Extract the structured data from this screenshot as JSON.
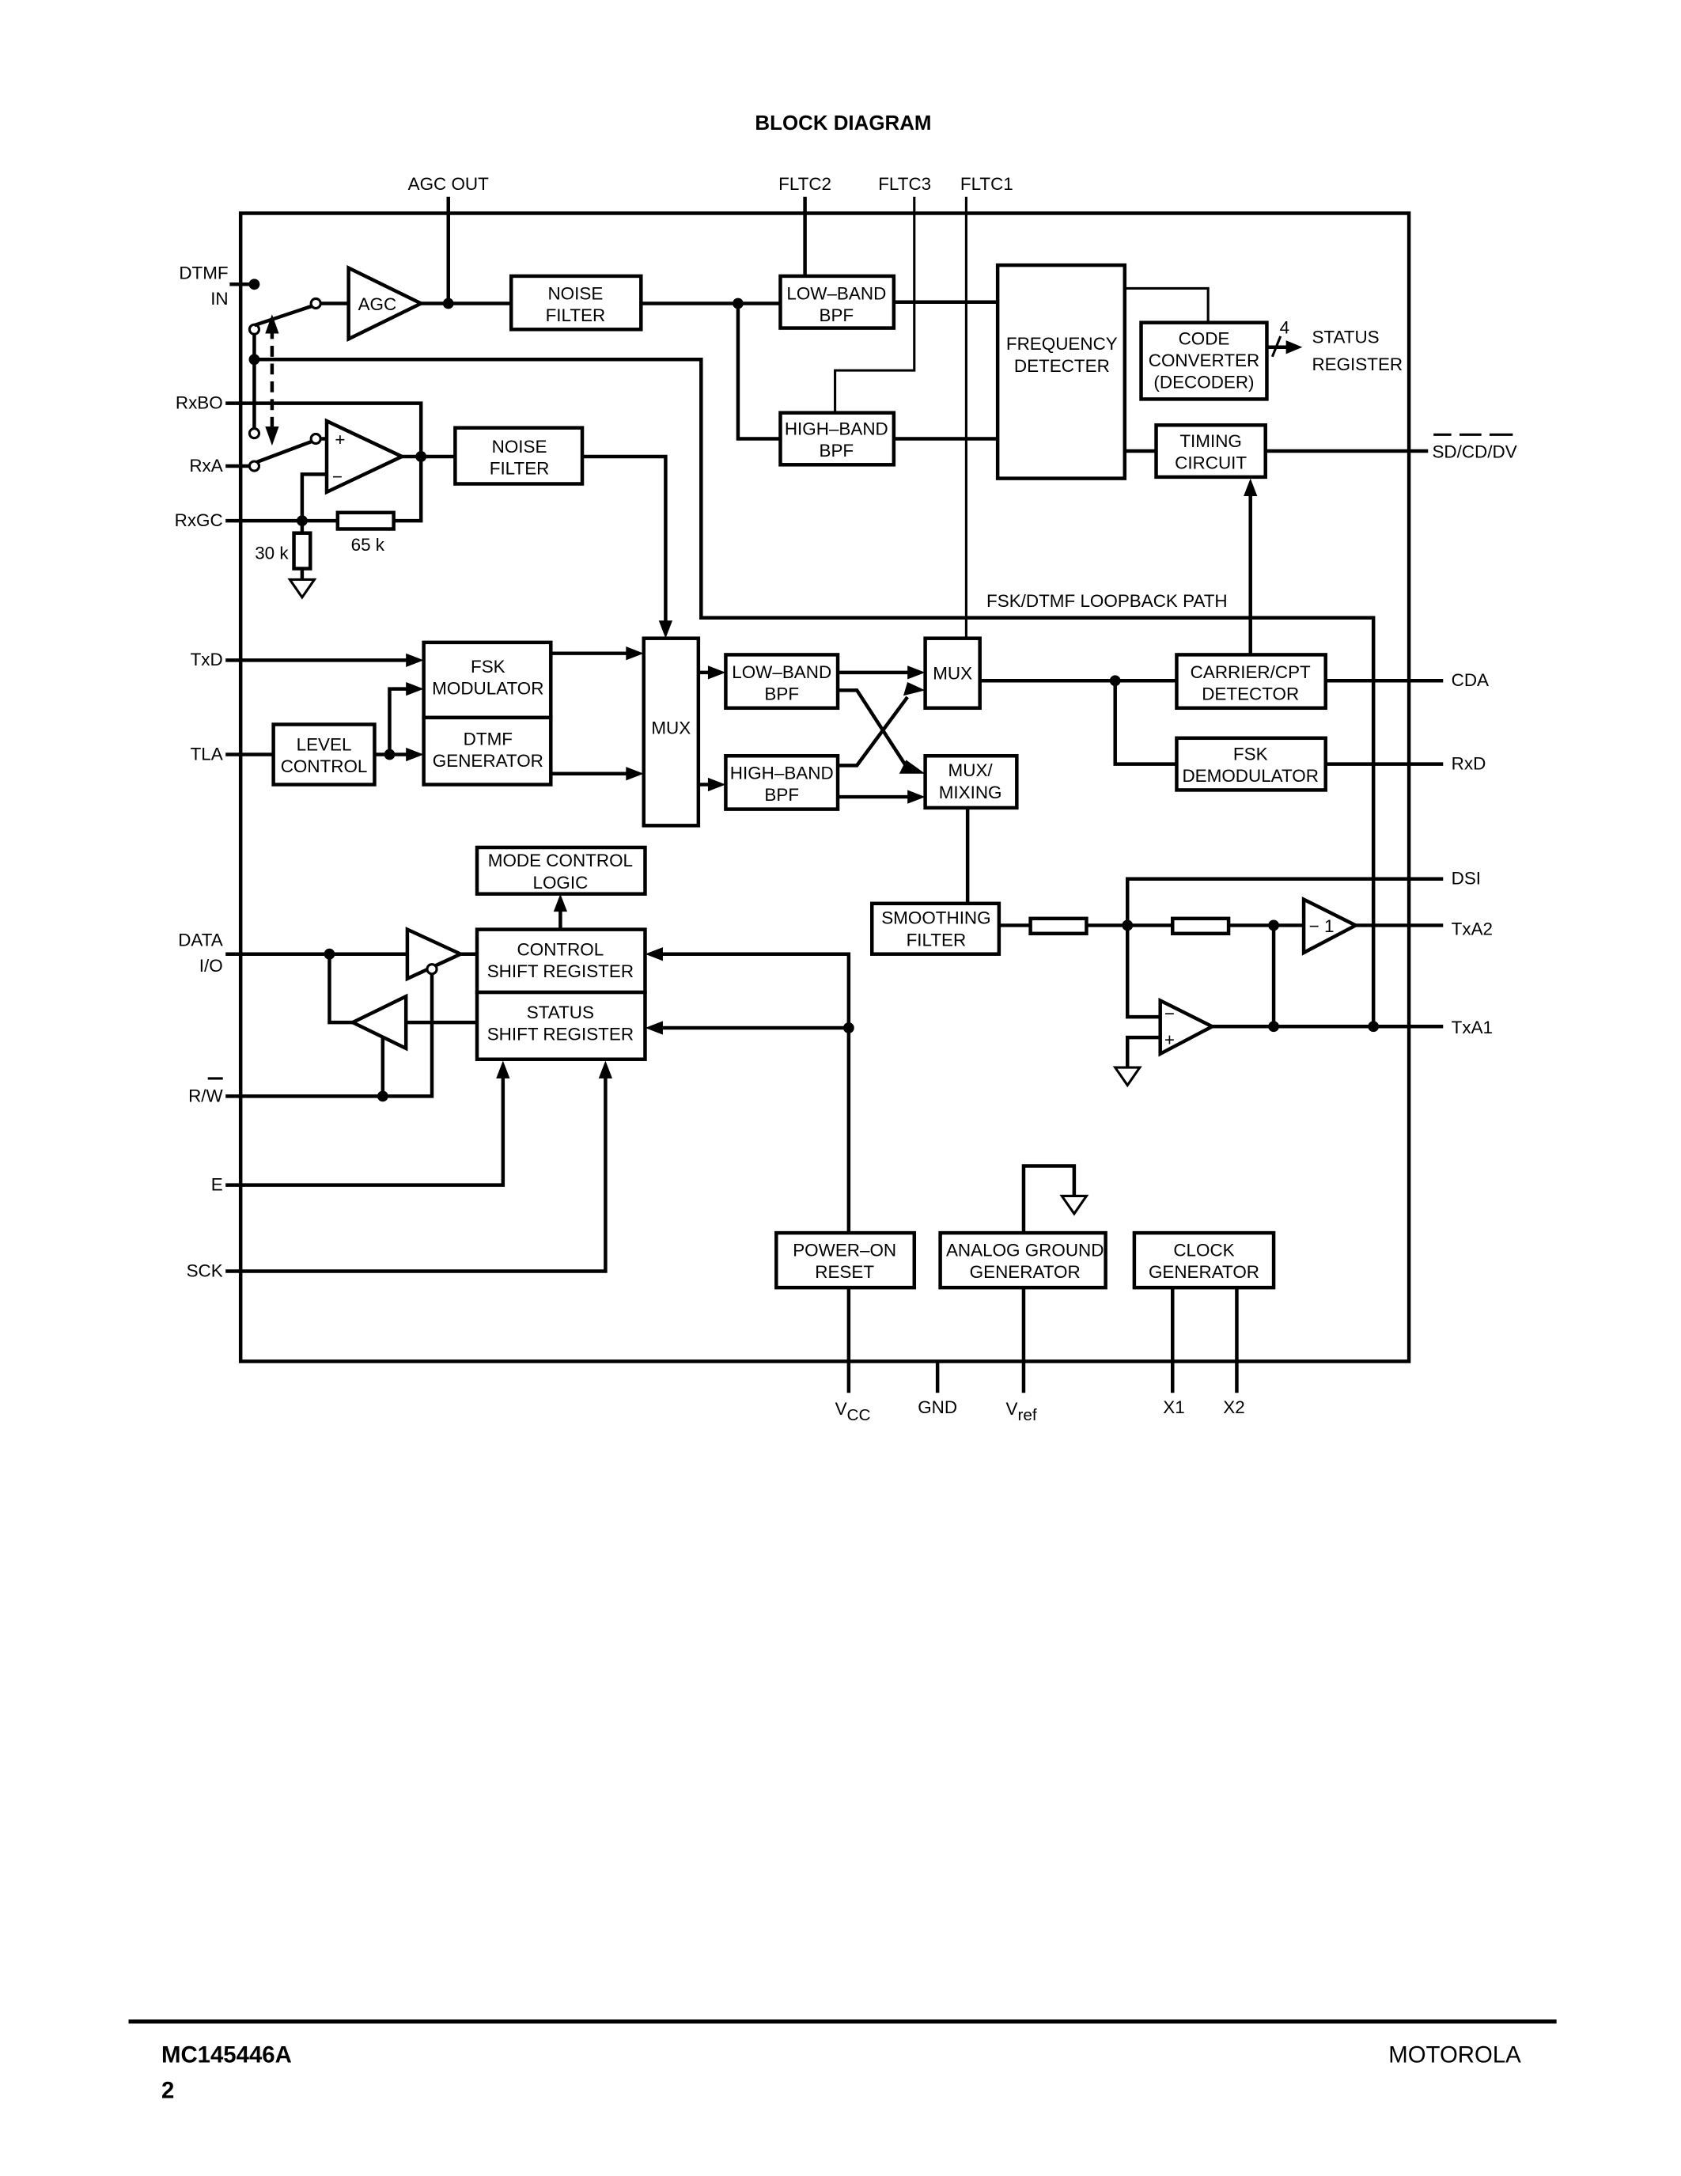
{
  "page": {
    "title": "BLOCK DIAGRAM",
    "footer": {
      "part_number": "MC145446A",
      "page_number": "2",
      "brand": "MOTOROLA"
    }
  },
  "pins_top": {
    "agc_out": "AGC OUT",
    "fltc2": "FLTC2",
    "fltc3": "FLTC3",
    "fltc1": "FLTC1"
  },
  "pins_left": {
    "dtmf_in_1": "DTMF",
    "dtmf_in_2": "IN",
    "rxbo": "RxBO",
    "rxa": "RxA",
    "rxgc": "RxGC",
    "txd": "TxD",
    "tla": "TLA",
    "data_io_1": "DATA",
    "data_io_2": "I/O",
    "rw": "R/W",
    "e": "E",
    "sck": "SCK"
  },
  "pins_right": {
    "status_register_1": "STATUS",
    "status_register_2": "REGISTER",
    "sd_cd_dv": "SD/CD/DV",
    "cda": "CDA",
    "rxd": "RxD",
    "dsi": "DSI",
    "txa2": "TxA2",
    "txa1": "TxA1"
  },
  "pins_bottom": {
    "vcc": "V",
    "vcc_sub": "CC",
    "gnd": "GND",
    "vref": "V",
    "vref_sub": "ref",
    "x1": "X1",
    "x2": "X2"
  },
  "components": {
    "resistor_30k": "30 k",
    "resistor_65k": "65 k",
    "bus_width": "4",
    "loopback_label": "FSK/DTMF LOOPBACK PATH",
    "agc": "AGC",
    "opamp_plus": "+",
    "opamp_minus": "−",
    "inverter": "− 1"
  },
  "blocks": {
    "noise_filter_1": [
      "NOISE",
      "FILTER"
    ],
    "noise_filter_2": [
      "NOISE",
      "FILTER"
    ],
    "low_band_bpf_rx": [
      "LOW–BAND",
      "BPF"
    ],
    "high_band_bpf_rx": [
      "HIGH–BAND",
      "BPF"
    ],
    "frequency_detecter": [
      "FREQUENCY",
      "DETECTER"
    ],
    "code_converter": [
      "CODE",
      "CONVERTER",
      "(DECODER)"
    ],
    "timing_circuit": [
      "TIMING",
      "CIRCUIT"
    ],
    "fsk_modulator": [
      "FSK",
      "MODULATOR"
    ],
    "dtmf_generator": [
      "DTMF",
      "GENERATOR"
    ],
    "level_control": [
      "LEVEL",
      "CONTROL"
    ],
    "mux_main": [
      "MUX"
    ],
    "low_band_bpf_tx": [
      "LOW–BAND",
      "BPF"
    ],
    "high_band_bpf_tx": [
      "HIGH–BAND",
      "BPF"
    ],
    "mux_small": [
      "MUX"
    ],
    "mux_mixing": [
      "MUX/",
      "MIXING"
    ],
    "carrier_cpt_detector": [
      "CARRIER/CPT",
      "DETECTOR"
    ],
    "fsk_demodulator": [
      "FSK",
      "DEMODULATOR"
    ],
    "mode_control_logic": [
      "MODE CONTROL",
      "LOGIC"
    ],
    "control_shift_register": [
      "CONTROL",
      "SHIFT REGISTER"
    ],
    "status_shift_register": [
      "STATUS",
      "SHIFT REGISTER"
    ],
    "smoothing_filter": [
      "SMOOTHING",
      "FILTER"
    ],
    "power_on_reset": [
      "POWER–ON",
      "RESET"
    ],
    "analog_ground_generator": [
      "ANALOG GROUND",
      "GENERATOR"
    ],
    "clock_generator": [
      "CLOCK",
      "GENERATOR"
    ]
  }
}
